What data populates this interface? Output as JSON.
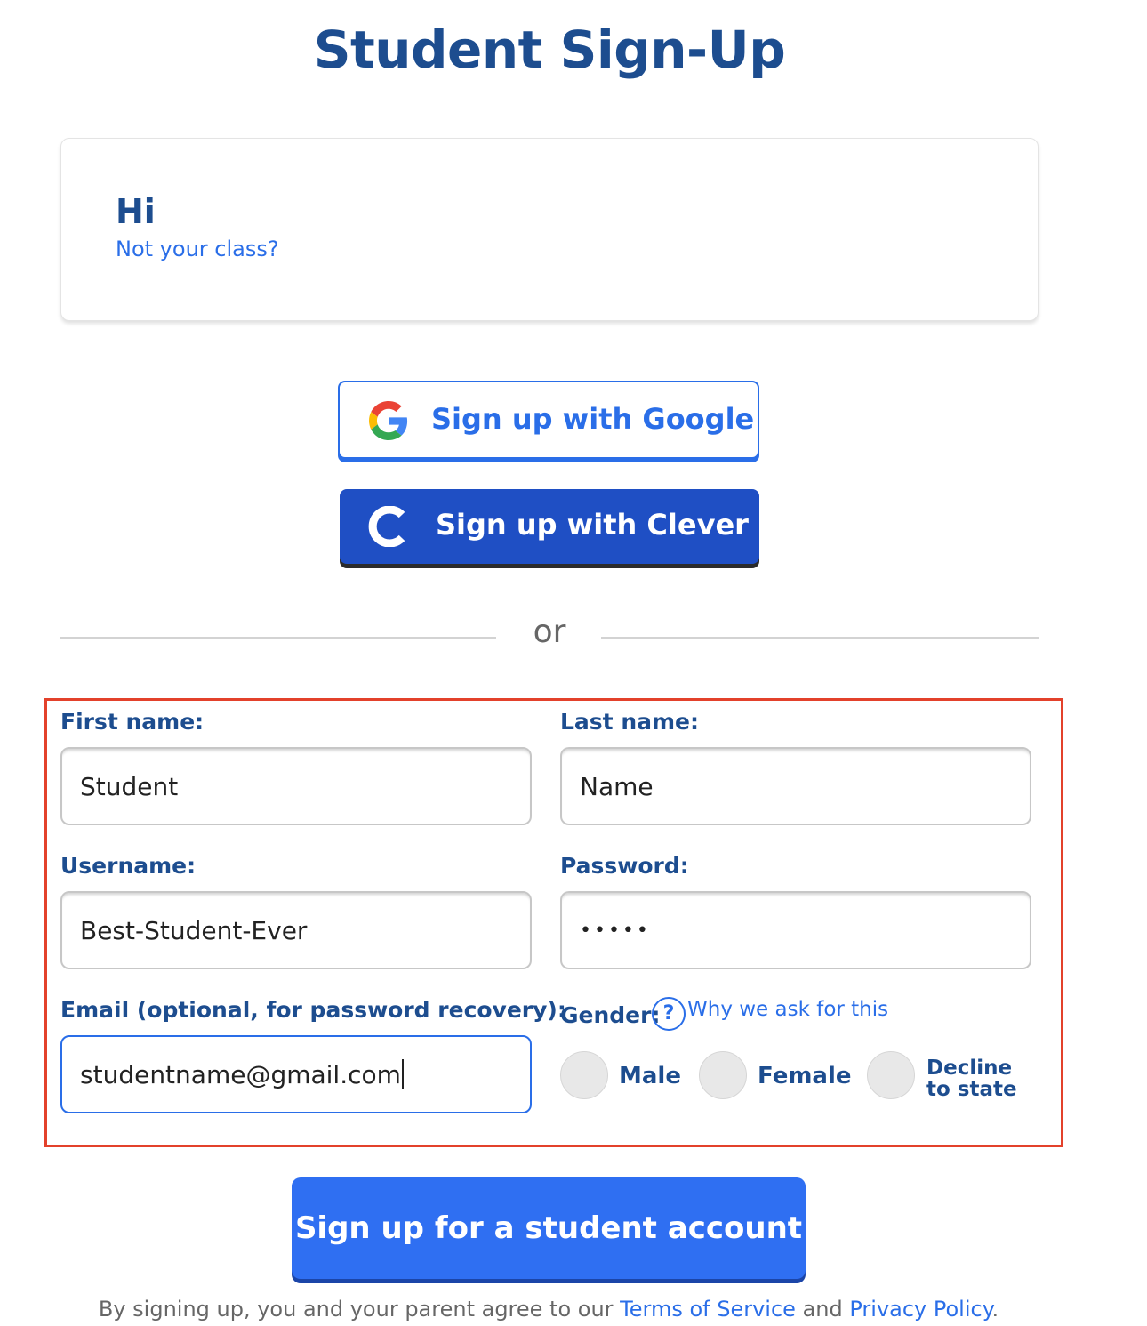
{
  "page": {
    "title": "Student Sign-Up"
  },
  "class_card": {
    "greeting": "Hi",
    "not_your_class": "Not your class?"
  },
  "social": {
    "google_label": "Sign up with Google",
    "clever_label": "Sign up with Clever"
  },
  "divider": {
    "text": "or"
  },
  "form": {
    "first_name": {
      "label": "First name:",
      "value": "Student"
    },
    "last_name": {
      "label": "Last name:",
      "value": "Name"
    },
    "username": {
      "label": "Username:",
      "value": "Best-Student-Ever"
    },
    "password": {
      "label": "Password:",
      "value": "•••••"
    },
    "email": {
      "label": "Email (optional, for password recovery):",
      "value": "studentname@gmail.com"
    },
    "gender": {
      "label": "Gender:",
      "help_glyph": "?",
      "why_link": "Why we ask for this",
      "options": [
        "Male",
        "Female",
        "Decline",
        "to state"
      ]
    }
  },
  "submit": {
    "label": "Sign up for a student account"
  },
  "legal": {
    "prefix": "By signing up, you and your parent agree to our ",
    "terms": "Terms of Service",
    "and": " and ",
    "privacy": "Privacy Policy",
    "suffix": "."
  },
  "colors": {
    "heading": "#1d4d8f",
    "link": "#2a6ee8",
    "clever": "#1f4fc4",
    "submit": "#2f6ff2",
    "highlight": "#e3412b"
  }
}
